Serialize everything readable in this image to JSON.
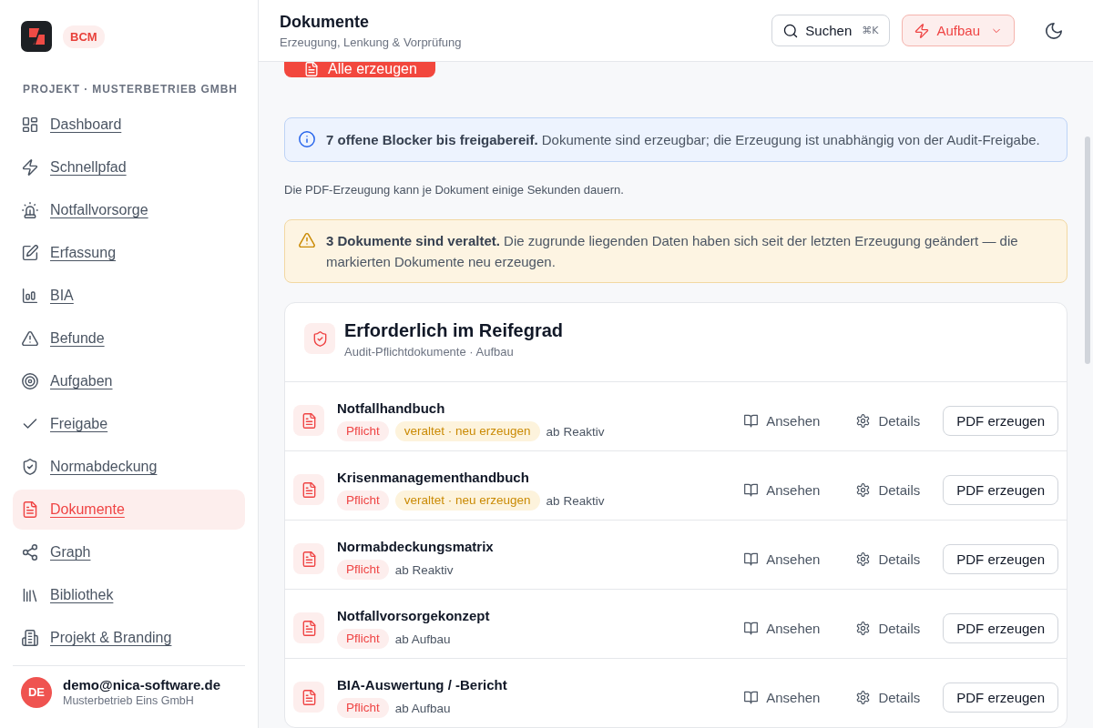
{
  "sidebar": {
    "brand": {
      "badge": "BCM"
    },
    "section_label": "PROJEKT · MUSTERBETRIEB GMBH",
    "items": [
      {
        "label": "Dashboard",
        "selected": false
      },
      {
        "label": "Schnellpfad",
        "selected": false
      },
      {
        "label": "Notfallvorsorge",
        "selected": false
      },
      {
        "label": "Erfassung",
        "selected": false
      },
      {
        "label": "BIA",
        "selected": false
      },
      {
        "label": "Befunde",
        "selected": false
      },
      {
        "label": "Aufgaben",
        "selected": false
      },
      {
        "label": "Freigabe",
        "selected": false
      },
      {
        "label": "Normabdeckung",
        "selected": false
      },
      {
        "label": "Dokumente",
        "selected": true
      },
      {
        "label": "Graph",
        "selected": false
      },
      {
        "label": "Bibliothek",
        "selected": false
      },
      {
        "label": "Projekt & Branding",
        "selected": false
      }
    ],
    "user": {
      "initials": "DE",
      "email": "demo@nica-software.de",
      "organization": "Musterbetrieb Eins GmbH"
    }
  },
  "header": {
    "title": "Dokumente",
    "subtitle": "Erzeugung, Lenkung & Vorprüfung",
    "search": {
      "label": "Suchen",
      "shortcut": "⌘K"
    },
    "level_menu": {
      "label": "Aufbau"
    }
  },
  "content": {
    "primary_action": {
      "label": "Alle erzeugen"
    },
    "notices": [
      {
        "kind": "info",
        "text": "**7 offene Blocker bis freigabereif.** Dokumente sind erzeugbar; die Erzeugung ist unabhängig von der Audit-Freigabe."
      },
      {
        "kind": "note",
        "text": "Die PDF-Erzeugung kann je Dokument einige Sekunden dauern."
      },
      {
        "kind": "warning",
        "text": "**3 Dokumente sind veraltet.** Die zugrunde liegenden Daten haben sich seit der letzten Erzeugung geändert — die markierten Dokumente neu erzeugen."
      }
    ],
    "card": {
      "title": "Erforderlich im Reifegrad",
      "subtitle": "Audit-Pflichtdokumente · Aufbau",
      "documents": [
        {
          "title": "Notfallhandbuch",
          "tags": [
            {
              "kind": "required",
              "label": "Pflicht"
            },
            {
              "kind": "outdated",
              "label": "veraltet · neu erzeugen"
            }
          ],
          "availability": "ab Reaktiv",
          "actions": {
            "view": "Ansehen",
            "details": "Details",
            "generate": "PDF erzeugen"
          }
        },
        {
          "title": "Krisenmanagementhandbuch",
          "tags": [
            {
              "kind": "required",
              "label": "Pflicht"
            },
            {
              "kind": "outdated",
              "label": "veraltet · neu erzeugen"
            }
          ],
          "availability": "ab Reaktiv",
          "actions": {
            "view": "Ansehen",
            "details": "Details",
            "generate": "PDF erzeugen"
          }
        },
        {
          "title": "Normabdeckungsmatrix",
          "tags": [
            {
              "kind": "required",
              "label": "Pflicht"
            }
          ],
          "availability": "ab Reaktiv",
          "actions": {
            "view": "Ansehen",
            "details": "Details",
            "generate": "PDF erzeugen"
          }
        },
        {
          "title": "Notfallvorsorgekonzept",
          "tags": [
            {
              "kind": "required",
              "label": "Pflicht"
            }
          ],
          "availability": "ab Aufbau",
          "actions": {
            "view": "Ansehen",
            "details": "Details",
            "generate": "PDF erzeugen"
          }
        },
        {
          "title": "BIA-Auswertung / -Bericht",
          "tags": [
            {
              "kind": "required",
              "label": "Pflicht"
            }
          ],
          "availability": "ab Aufbau",
          "actions": {
            "view": "Ansehen",
            "details": "Details",
            "generate": "PDF erzeugen"
          }
        }
      ]
    }
  }
}
